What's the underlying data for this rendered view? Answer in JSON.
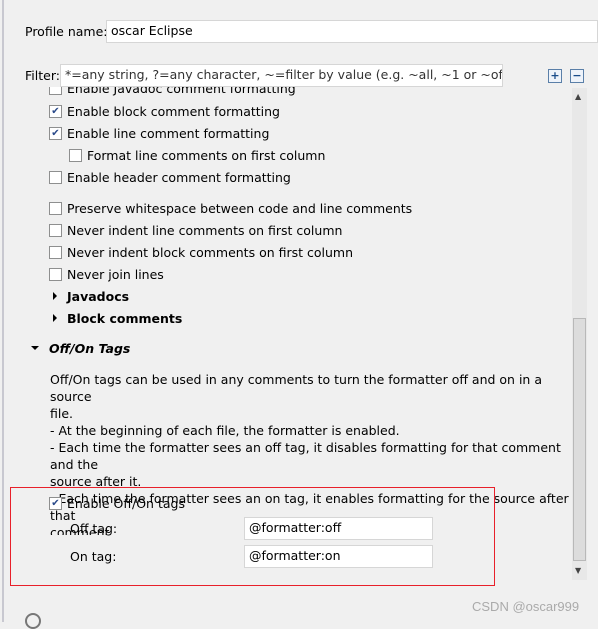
{
  "profile": {
    "label": "Profile name:",
    "value": "oscar Eclipse"
  },
  "filter": {
    "label": "Filter:",
    "placeholder": "*=any string, ?=any character, ~=filter by value (e.g. ~all, ~1 or ~off)"
  },
  "options": [
    {
      "label": "Enable Javadoc comment formatting",
      "checked": false
    },
    {
      "label": "Enable block comment formatting",
      "checked": true
    },
    {
      "label": "Enable line comment formatting",
      "checked": true
    },
    {
      "label": "Format line comments on first column",
      "checked": false
    },
    {
      "label": "Enable header comment formatting",
      "checked": false
    },
    {
      "label": "Preserve whitespace between code and line comments",
      "checked": false
    },
    {
      "label": "Never indent line comments on first column",
      "checked": false
    },
    {
      "label": "Never indent block comments on first column",
      "checked": false
    },
    {
      "label": "Never join lines",
      "checked": false
    }
  ],
  "sections": {
    "javadocs": "Javadocs",
    "block_comments": "Block comments",
    "offon": "Off/On Tags"
  },
  "description": [
    "Off/On tags can be used in any comments to turn the formatter off and on in a source",
    "file.",
    "- At the beginning of each file, the formatter is enabled.",
    "- Each time the formatter sees an off tag, it disables formatting for that comment and the",
    "source after it.",
    "- Each time the formatter sees an on tag, it enables formatting for the source after that",
    "comment."
  ],
  "offon": {
    "enable_label": "Enable Off/On tags",
    "enabled": true,
    "off_label": "Off tag:",
    "off_value": "@formatter:off",
    "on_label": "On tag:",
    "on_value": "@formatter:on"
  },
  "watermark": "CSDN @oscar999"
}
